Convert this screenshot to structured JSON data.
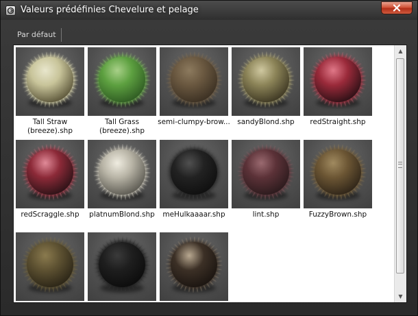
{
  "window": {
    "title": "Valeurs prédéfinies Chevelure et pelage",
    "icon": "app-logo-icon",
    "close_icon": "close-icon"
  },
  "tabs": [
    {
      "label": "Par défaut",
      "selected": true
    }
  ],
  "presets": [
    {
      "label": "Tall Straw\n(breeze).shp",
      "core": "#5a5438",
      "hair": "#c8c49a",
      "tip": "#e8e6cc"
    },
    {
      "label": "Tall Grass\n(breeze).shp",
      "core": "#2e5a22",
      "hair": "#5da040",
      "tip": "#a8d088"
    },
    {
      "label": "semi-clumpy-brow...",
      "core": "#3a2f22",
      "hair": "#6a5840",
      "tip": "#8c7a5e"
    },
    {
      "label": "sandyBlond.shp",
      "core": "#3c3622",
      "hair": "#8c8458",
      "tip": "#cfc8a0"
    },
    {
      "label": "redStraight.shp",
      "core": "#2a1015",
      "hair": "#9a2a3a",
      "tip": "#e07888"
    },
    {
      "label": "redScraggle.shp",
      "core": "#2a1216",
      "hair": "#8c2a38",
      "tip": "#e08a98"
    },
    {
      "label": "platnumBlond.shp",
      "core": "#5a5850",
      "hair": "#b8b4a6",
      "tip": "#efece0"
    },
    {
      "label": "meHulkaaaar.shp",
      "core": "#0f0f0f",
      "hair": "#222222",
      "tip": "#505050"
    },
    {
      "label": "lint.shp",
      "core": "#2a1a1c",
      "hair": "#5c3238",
      "tip": "#9a6a70"
    },
    {
      "label": "FuzzyBrown.shp",
      "core": "#2e2418",
      "hair": "#6c5634",
      "tip": "#a08a60"
    },
    {
      "label": "",
      "core": "#2a2416",
      "hair": "#5e5232",
      "tip": "#8a7a4e"
    },
    {
      "label": "",
      "core": "#0c0c0c",
      "hair": "#1e1e1e",
      "tip": "#3a3a3a"
    },
    {
      "label": "",
      "core": "#1a1410",
      "hair": "#3c3026",
      "tip": "#b8a890"
    }
  ],
  "scrollbar": {
    "up_icon": "scroll-up-arrow-icon",
    "down_icon": "scroll-down-arrow-icon",
    "up_glyph": "▲",
    "down_glyph": "▼"
  }
}
